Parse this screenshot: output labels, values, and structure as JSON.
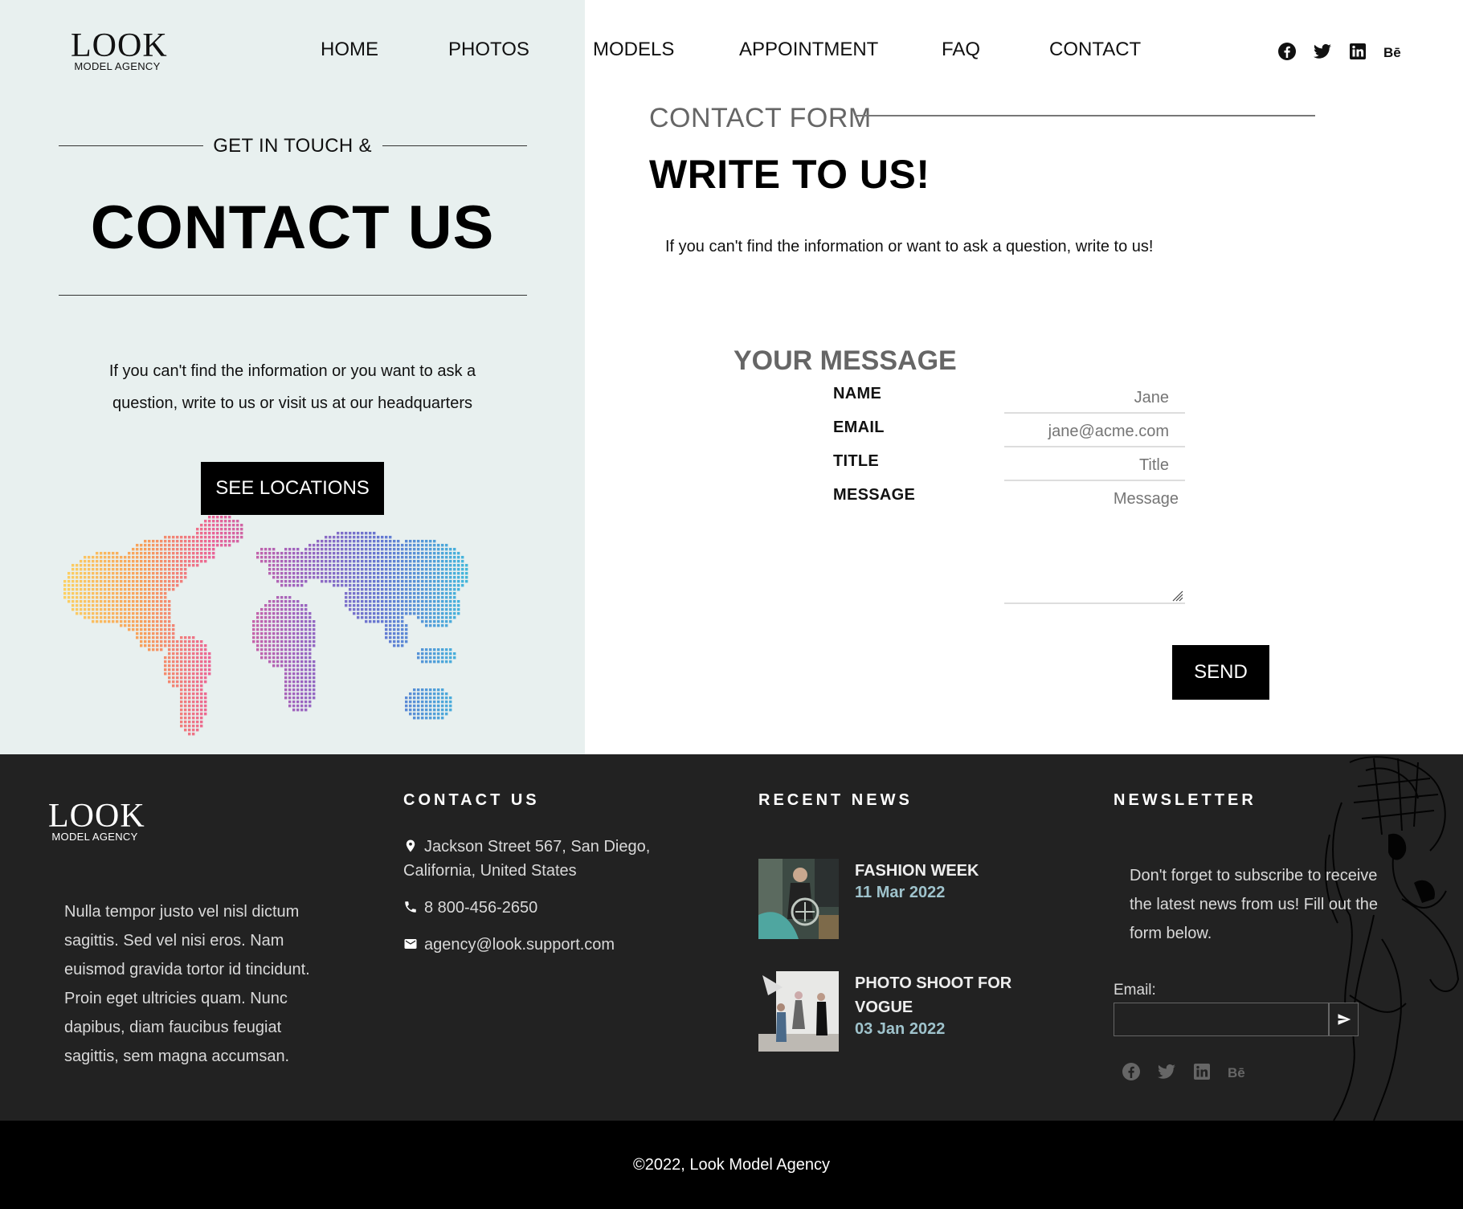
{
  "brand": {
    "name": "LOOK",
    "tagline": "MODEL AGENCY"
  },
  "nav": [
    {
      "label": "HOME"
    },
    {
      "label": "PHOTOS"
    },
    {
      "label": "MODELS"
    },
    {
      "label": "APPOINTMENT"
    },
    {
      "label": "FAQ"
    },
    {
      "label": "CONTACT"
    }
  ],
  "social_icons": [
    "facebook-icon",
    "twitter-icon",
    "linkedin-icon",
    "behance-icon"
  ],
  "hero": {
    "eyebrow": "GET IN TOUCH &",
    "title": "CONTACT US",
    "description": "If you can't find the information or you want to ask a question, write to us or visit us at our headquarters",
    "button": "SEE LOCATIONS"
  },
  "contact_form": {
    "eyebrow": "CONTACT FORM",
    "title": "WRITE TO US!",
    "description": "If you can't find the information or want to ask a question, write to us!",
    "section_title": "YOUR MESSAGE",
    "fields": {
      "name": {
        "label": "NAME",
        "placeholder": "Jane"
      },
      "email": {
        "label": "EMAIL",
        "placeholder": "jane@acme.com"
      },
      "title": {
        "label": "TITLE",
        "placeholder": "Title"
      },
      "message": {
        "label": "MESSAGE",
        "placeholder": "Message"
      }
    },
    "submit": "SEND"
  },
  "footer": {
    "about": "Nulla tempor justo vel nisl dictum sagittis. Sed vel nisi eros. Nam euismod gravida tortor id tincidunt. Proin eget ultricies quam. Nunc dapibus, diam faucibus feugiat sagittis, sem magna accumsan.",
    "contact": {
      "title": "CONTACT US",
      "address": "Jackson Street 567, San Diego, California, United States",
      "phone": "8 800-456-2650",
      "email": "agency@look.support.com"
    },
    "news": {
      "title": "RECENT NEWS",
      "items": [
        {
          "title": "FASHION WEEK",
          "date": "11 Mar 2022"
        },
        {
          "title": "PHOTO SHOOT FOR VOGUE",
          "date": "03 Jan 2022"
        }
      ]
    },
    "newsletter": {
      "title": "NEWSLETTER",
      "text": "Don't forget to subscribe to receive the latest news from us! Fill out the form below.",
      "email_label": "Email:"
    },
    "copyright": "©2022, Look Model Agency"
  },
  "colors": {
    "panel_bg": "#e8f0ef",
    "footer_bg": "#222222",
    "accent_date": "#9fc3cc",
    "button_bg": "#000000"
  }
}
